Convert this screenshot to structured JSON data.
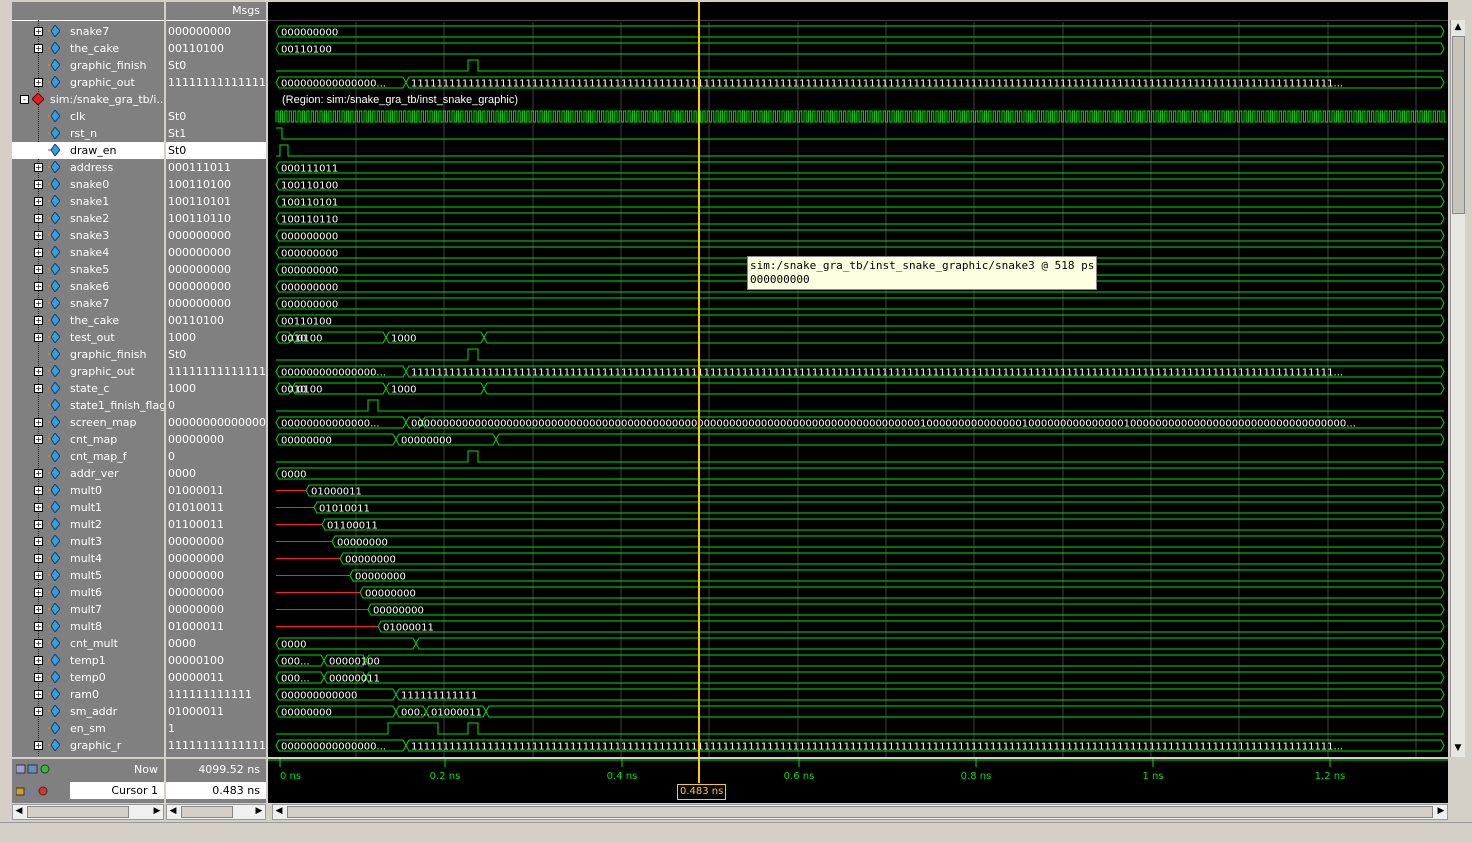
{
  "header": {
    "msgs_label": "Msgs"
  },
  "signals": [
    {
      "name": "snake7",
      "value": "000000000",
      "kind": "bus",
      "exp": "+",
      "wave": [
        {
          "t": "000000000"
        }
      ]
    },
    {
      "name": "the_cake",
      "value": "00110100",
      "kind": "bus",
      "exp": "+",
      "wave": [
        {
          "t": "00110100"
        }
      ]
    },
    {
      "name": "graphic_finish",
      "value": "St0",
      "kind": "bit",
      "exp": "",
      "wave": []
    },
    {
      "name": "graphic_out",
      "value": "11111111111111...",
      "kind": "bus",
      "exp": "+",
      "wave": [
        {
          "t": "000000000000000..."
        },
        {
          "t": "1111111111111111111111111111111111111111111111111111111111111111111111111111111111111111111111111111111111111111111111111111111111111111111111111..."
        }
      ]
    },
    {
      "name": "sim:/snake_gra_tb/i...",
      "value": "",
      "kind": "region",
      "exp": "-",
      "wave": [
        {
          "t": "(Region: sim:/snake_gra_tb/inst_snake_graphic)"
        }
      ]
    },
    {
      "name": "clk",
      "value": "St0",
      "kind": "clk",
      "exp": "",
      "wave": []
    },
    {
      "name": "rst_n",
      "value": "St1",
      "kind": "bit",
      "exp": "",
      "wave": []
    },
    {
      "name": "draw_en",
      "value": "St0",
      "kind": "bit",
      "exp": "",
      "wave": []
    },
    {
      "name": "address",
      "value": "000111011",
      "kind": "bus",
      "exp": "+",
      "wave": [
        {
          "t": "000111011"
        }
      ]
    },
    {
      "name": "snake0",
      "value": "100110100",
      "kind": "bus",
      "exp": "+",
      "wave": [
        {
          "t": "100110100"
        }
      ]
    },
    {
      "name": "snake1",
      "value": "100110101",
      "kind": "bus",
      "exp": "+",
      "wave": [
        {
          "t": "100110101"
        }
      ]
    },
    {
      "name": "snake2",
      "value": "100110110",
      "kind": "bus",
      "exp": "+",
      "wave": [
        {
          "t": "100110110"
        }
      ]
    },
    {
      "name": "snake3",
      "value": "000000000",
      "kind": "bus",
      "exp": "+",
      "wave": [
        {
          "t": "000000000"
        }
      ]
    },
    {
      "name": "snake4",
      "value": "000000000",
      "kind": "bus",
      "exp": "+",
      "wave": [
        {
          "t": "000000000"
        }
      ]
    },
    {
      "name": "snake5",
      "value": "000000000",
      "kind": "bus",
      "exp": "+",
      "wave": [
        {
          "t": "000000000"
        }
      ]
    },
    {
      "name": "snake6",
      "value": "000000000",
      "kind": "bus",
      "exp": "+",
      "wave": [
        {
          "t": "000000000"
        }
      ]
    },
    {
      "name": "snake7",
      "value": "000000000",
      "kind": "bus",
      "exp": "+",
      "wave": [
        {
          "t": "000000000"
        }
      ]
    },
    {
      "name": "the_cake",
      "value": "00110100",
      "kind": "bus",
      "exp": "+",
      "wave": [
        {
          "t": "00110100"
        }
      ]
    },
    {
      "name": "test_out",
      "value": "1000",
      "kind": "bus",
      "exp": "+",
      "wave": [
        {
          "t": "0010"
        },
        {
          "t": "0100"
        },
        {
          "t": "1000"
        }
      ]
    },
    {
      "name": "graphic_finish",
      "value": "St0",
      "kind": "bit",
      "exp": "",
      "wave": []
    },
    {
      "name": "graphic_out",
      "value": "11111111111111...",
      "kind": "bus",
      "exp": "+",
      "wave": [
        {
          "t": "000000000000000..."
        },
        {
          "t": "1111111111111111111111111111111111111111111111111111111111111111111111111111111111111111111111111111111111111111111111111111111111111111111111111..."
        }
      ]
    },
    {
      "name": "state_c",
      "value": "1000",
      "kind": "bus",
      "exp": "+",
      "wave": [
        {
          "t": "0010"
        },
        {
          "t": "0100"
        },
        {
          "t": "1000"
        }
      ]
    },
    {
      "name": "state1_finish_flag",
      "value": "0",
      "kind": "bit",
      "exp": "",
      "wave": []
    },
    {
      "name": "screen_map",
      "value": "00000000000000...",
      "kind": "bus",
      "exp": "+",
      "wave": [
        {
          "t": "00000000000000..."
        },
        {
          "t": "000000000000000000000000000000000000000000000000000000000000000000000000000000001000000000000000100000000000000010000000000000000000000000000000000..."
        }
      ]
    },
    {
      "name": "cnt_map",
      "value": "00000000",
      "kind": "bus",
      "exp": "+",
      "wave": [
        {
          "t": "00000000"
        },
        {
          "t": "00000000"
        }
      ]
    },
    {
      "name": "cnt_map_f",
      "value": "0",
      "kind": "bit",
      "exp": "",
      "wave": []
    },
    {
      "name": "addr_ver",
      "value": "0000",
      "kind": "bus",
      "exp": "+",
      "wave": [
        {
          "t": "0000"
        }
      ]
    },
    {
      "name": "mult0",
      "value": "01000011",
      "kind": "bus",
      "exp": "+",
      "wave": [
        {
          "t": "01000011"
        }
      ]
    },
    {
      "name": "mult1",
      "value": "01010011",
      "kind": "bus",
      "exp": "+",
      "wave": [
        {
          "t": "01010011"
        }
      ]
    },
    {
      "name": "mult2",
      "value": "01100011",
      "kind": "bus",
      "exp": "+",
      "wave": [
        {
          "t": "01100011"
        }
      ]
    },
    {
      "name": "mult3",
      "value": "00000000",
      "kind": "bus",
      "exp": "+",
      "wave": [
        {
          "t": "00000000"
        }
      ]
    },
    {
      "name": "mult4",
      "value": "00000000",
      "kind": "bus",
      "exp": "+",
      "wave": [
        {
          "t": "00000000"
        }
      ]
    },
    {
      "name": "mult5",
      "value": "00000000",
      "kind": "bus",
      "exp": "+",
      "wave": [
        {
          "t": "00000000"
        }
      ]
    },
    {
      "name": "mult6",
      "value": "00000000",
      "kind": "bus",
      "exp": "+",
      "wave": [
        {
          "t": "00000000"
        }
      ]
    },
    {
      "name": "mult7",
      "value": "00000000",
      "kind": "bus",
      "exp": "+",
      "wave": [
        {
          "t": "00000000"
        }
      ]
    },
    {
      "name": "mult8",
      "value": "01000011",
      "kind": "bus",
      "exp": "+",
      "wave": [
        {
          "t": "01000011"
        }
      ]
    },
    {
      "name": "cnt_mult",
      "value": "0000",
      "kind": "bus",
      "exp": "+",
      "wave": [
        {
          "t": "0000"
        }
      ]
    },
    {
      "name": "temp1",
      "value": "00000100",
      "kind": "bus",
      "exp": "+",
      "wave": [
        {
          "t": "000..."
        },
        {
          "t": "00000100"
        }
      ]
    },
    {
      "name": "temp0",
      "value": "00000011",
      "kind": "bus",
      "exp": "+",
      "wave": [
        {
          "t": "000..."
        },
        {
          "t": "00000011"
        }
      ]
    },
    {
      "name": "ram0",
      "value": "111111111111",
      "kind": "bus",
      "exp": "+",
      "wave": [
        {
          "t": "000000000000"
        },
        {
          "t": "111111111111"
        }
      ]
    },
    {
      "name": "sm_addr",
      "value": "01000011",
      "kind": "bus",
      "exp": "+",
      "wave": [
        {
          "t": "00000000"
        },
        {
          "t": "000..."
        },
        {
          "t": "01000011"
        }
      ]
    },
    {
      "name": "en_sm",
      "value": "1",
      "kind": "bit",
      "exp": "",
      "wave": []
    },
    {
      "name": "graphic_r",
      "value": "11111111111111...",
      "kind": "bus",
      "exp": "+",
      "wave": [
        {
          "t": "000000000000000..."
        },
        {
          "t": "1111111111111111111111111111111111111111111111111111111111111111111111111111111111111111111111111111111111111111111111111111111111111111111111111..."
        }
      ]
    }
  ],
  "bottom": {
    "now_label": "Now",
    "now_value": "4099.52 ns",
    "cursor_label": "Cursor 1",
    "cursor_value": "0.483 ns",
    "cursor_flag": "0.483 ns",
    "ticks": [
      "0 ns",
      "0.2 ns",
      "0.4 ns",
      "0.6 ns",
      "0.8 ns",
      "1 ns",
      "1.2 ns"
    ]
  },
  "tooltip": {
    "path": "sim:/snake_gra_tb/inst_snake_graphic/snake3 @ 518 ps",
    "value": "000000000"
  },
  "colors": {
    "wave": "#00e000",
    "cursor": "#ffcc00",
    "bg": "#000000",
    "red": "#ff2020",
    "pane": "#808080"
  },
  "selected_signal": "draw_en"
}
